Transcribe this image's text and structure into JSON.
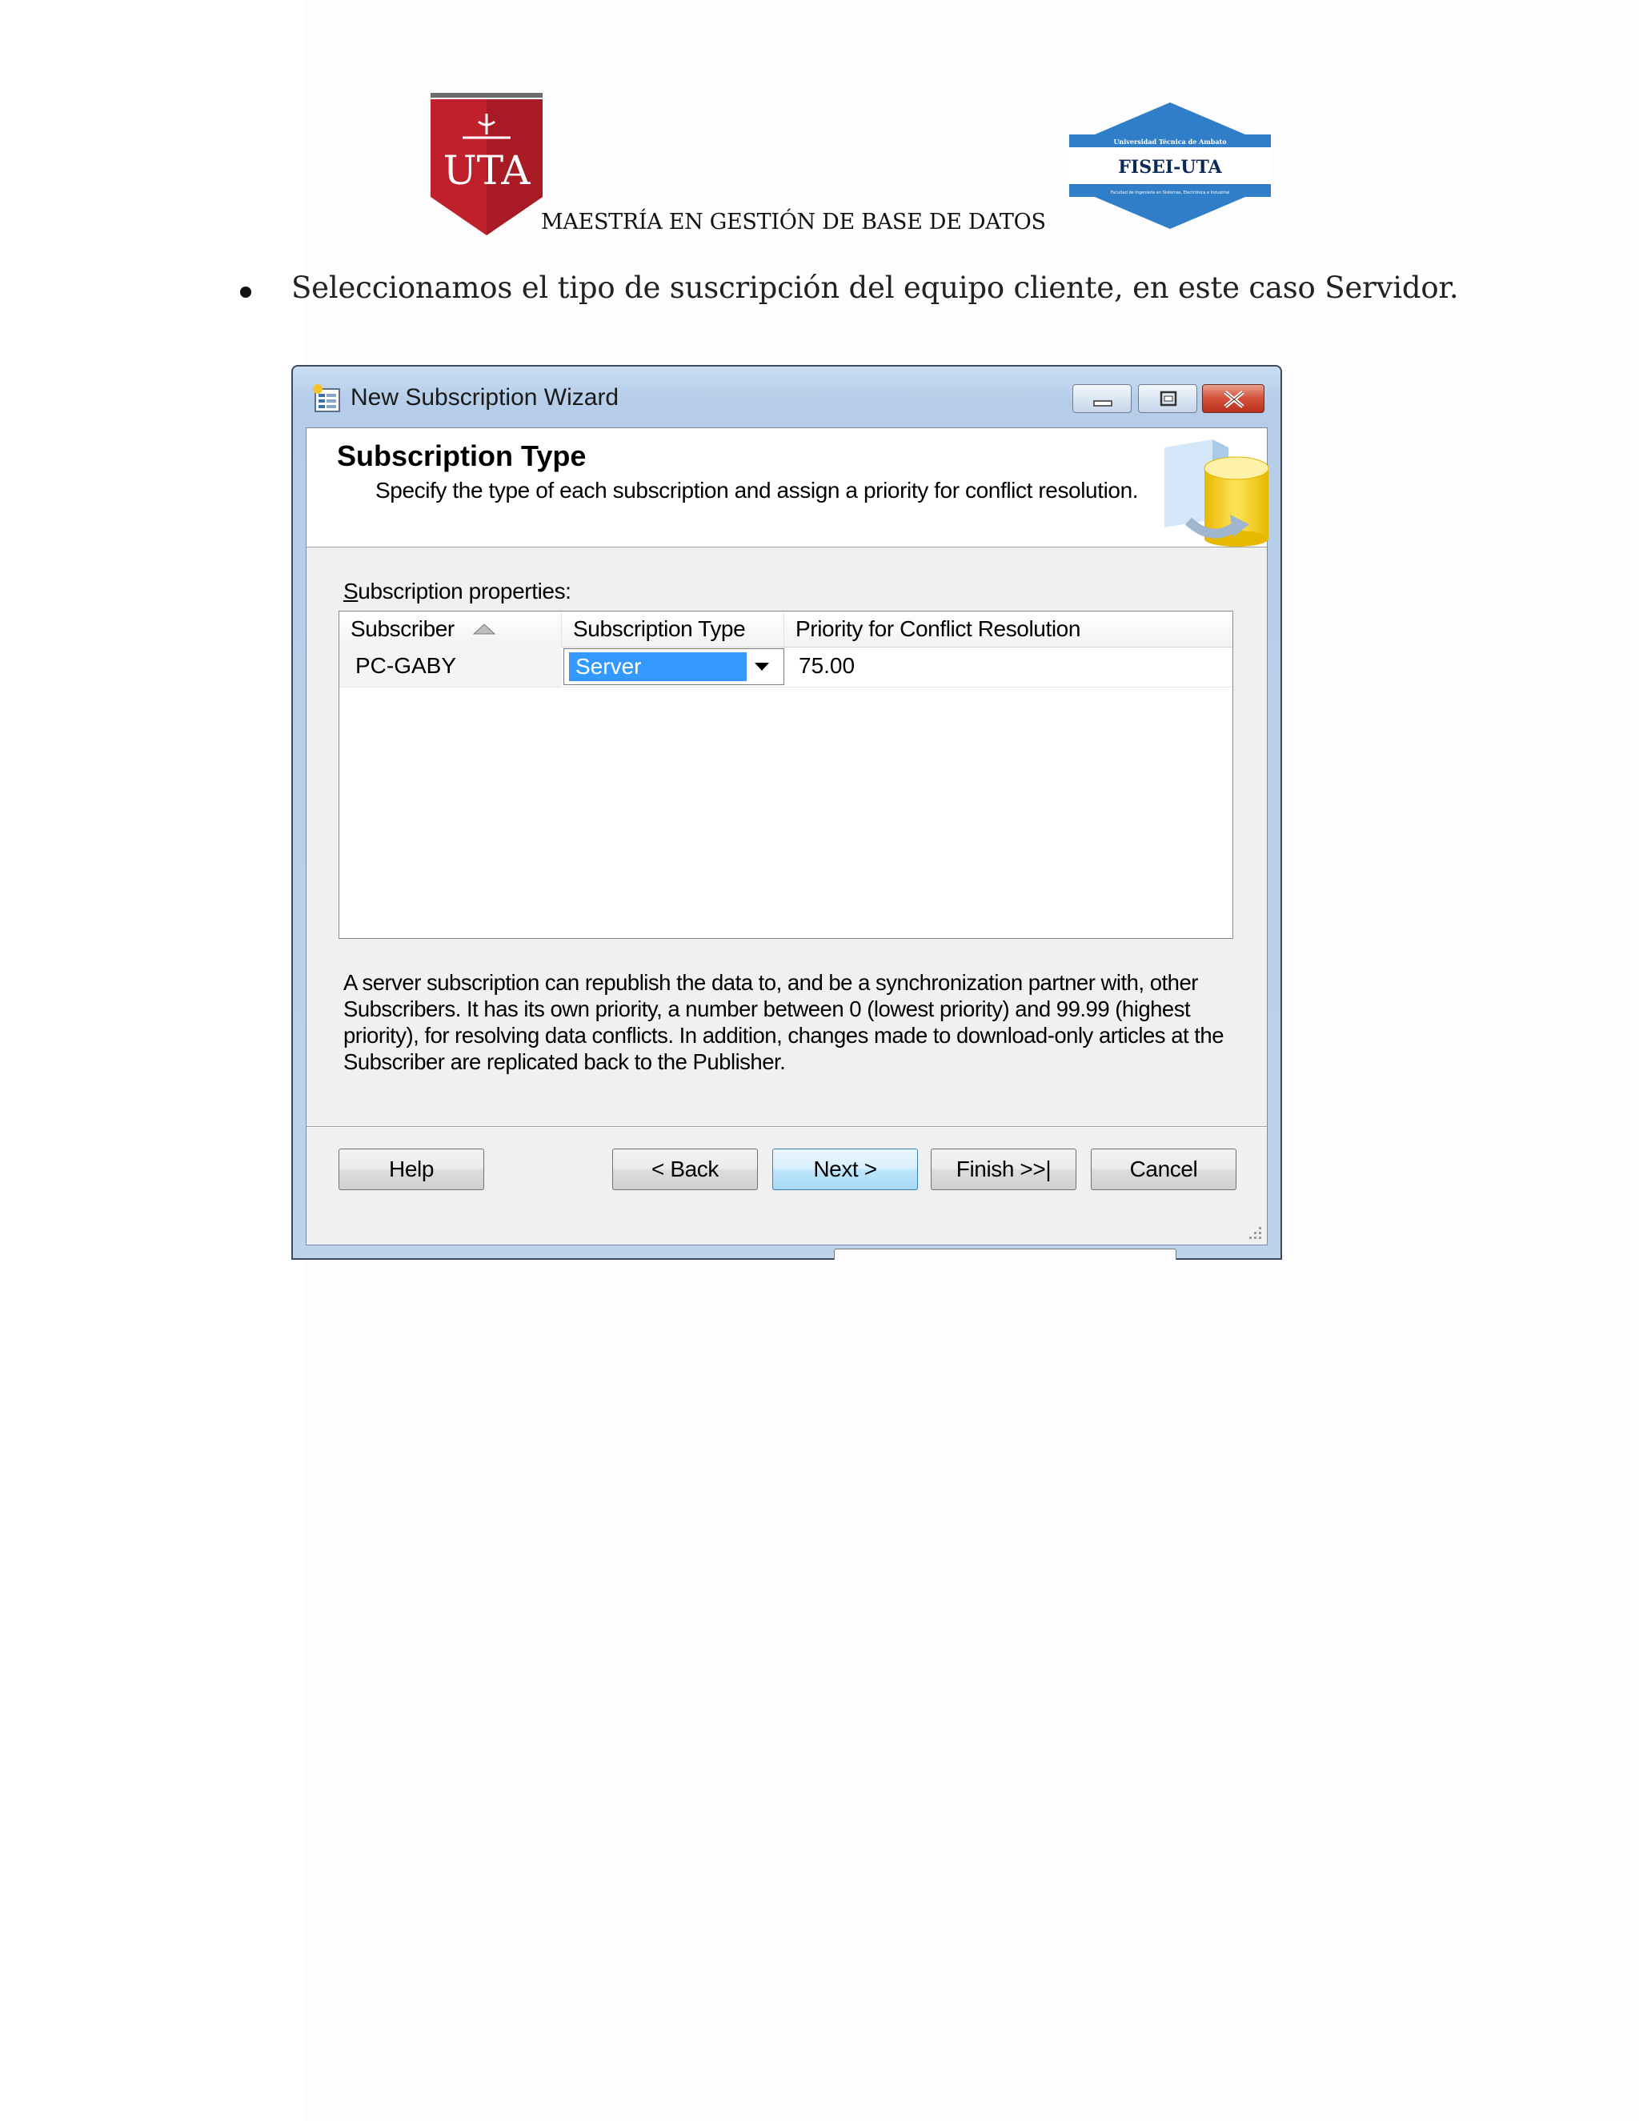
{
  "header": {
    "uta_logo_text": "UTA",
    "fisei_logo_top": "Universidad Técnica de Ambato",
    "fisei_logo_main": "FISEI-UTA",
    "fisei_logo_bottom": "Facultad de Ingeniería en Sistemas, Electrónica e Industrial",
    "program_title": "MAESTRÍA EN GESTIÓN DE BASE DE DATOS"
  },
  "instruction": {
    "text": "Seleccionamos el tipo de suscripción del equipo cliente, en este caso Servidor."
  },
  "dialog": {
    "title": "New Subscription Wizard",
    "banner_title": "Subscription Type",
    "banner_subtitle": "Specify the type of each subscription and assign a priority for conflict resolution.",
    "properties_label_accel": "S",
    "properties_label_rest": "ubscription properties:",
    "columns": [
      "Subscriber",
      "Subscription Type",
      "Priority for Conflict Resolution"
    ],
    "rows": [
      {
        "subscriber": "PC-GABY",
        "type": "Server",
        "priority": "75.00"
      }
    ],
    "description": "A server subscription can republish the data to, and be a synchronization partner with, other Subscribers. It has its own priority, a number between 0 (lowest priority) and 99.99 (highest priority), for resolving data conflicts. In addition, changes made to download-only articles at the Subscriber are replicated back to the Publisher.",
    "buttons": {
      "help": "Help",
      "back": "< Back",
      "next": "Next >",
      "finish": "Finish >>|",
      "cancel": "Cancel"
    }
  },
  "colors": {
    "uta_red": "#c0202b",
    "fisei_blue": "#2f7ec7",
    "selection_blue": "#3399ff"
  }
}
